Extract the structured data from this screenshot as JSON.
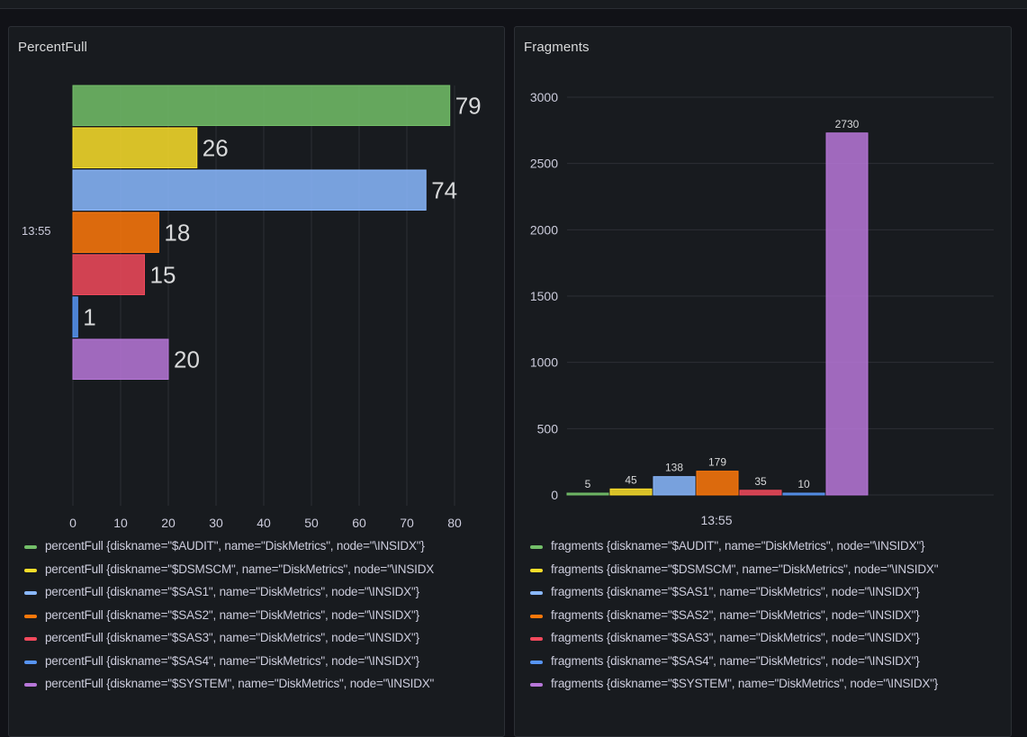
{
  "panels": [
    {
      "title": "PercentFull",
      "legend": [
        {
          "label": "percentFull {diskname=\"$AUDIT\", name=\"DiskMetrics\", node=\"\\INSIDX\"}",
          "color": "#73bf69"
        },
        {
          "label": "percentFull {diskname=\"$DSMSCM\", name=\"DiskMetrics\", node=\"\\INSIDX",
          "color": "#fade2a"
        },
        {
          "label": "percentFull {diskname=\"$SAS1\", name=\"DiskMetrics\", node=\"\\INSIDX\"}",
          "color": "#8ab8ff"
        },
        {
          "label": "percentFull {diskname=\"$SAS2\", name=\"DiskMetrics\", node=\"\\INSIDX\"}",
          "color": "#ff780a"
        },
        {
          "label": "percentFull {diskname=\"$SAS3\", name=\"DiskMetrics\", node=\"\\INSIDX\"}",
          "color": "#f2495c"
        },
        {
          "label": "percentFull {diskname=\"$SAS4\", name=\"DiskMetrics\", node=\"\\INSIDX\"}",
          "color": "#5794f2"
        },
        {
          "label": "percentFull {diskname=\"$SYSTEM\", name=\"DiskMetrics\", node=\"\\INSIDX\"",
          "color": "#b877d9"
        }
      ]
    },
    {
      "title": "Fragments",
      "legend": [
        {
          "label": "fragments {diskname=\"$AUDIT\", name=\"DiskMetrics\", node=\"\\INSIDX\"}",
          "color": "#73bf69"
        },
        {
          "label": "fragments {diskname=\"$DSMSCM\", name=\"DiskMetrics\", node=\"\\INSIDX\"",
          "color": "#fade2a"
        },
        {
          "label": "fragments {diskname=\"$SAS1\", name=\"DiskMetrics\", node=\"\\INSIDX\"}",
          "color": "#8ab8ff"
        },
        {
          "label": "fragments {diskname=\"$SAS2\", name=\"DiskMetrics\", node=\"\\INSIDX\"}",
          "color": "#ff780a"
        },
        {
          "label": "fragments {diskname=\"$SAS3\", name=\"DiskMetrics\", node=\"\\INSIDX\"}",
          "color": "#f2495c"
        },
        {
          "label": "fragments {diskname=\"$SAS4\", name=\"DiskMetrics\", node=\"\\INSIDX\"}",
          "color": "#5794f2"
        },
        {
          "label": "fragments {diskname=\"$SYSTEM\", name=\"DiskMetrics\", node=\"\\INSIDX\"}",
          "color": "#b877d9"
        }
      ]
    }
  ],
  "chart_data": [
    {
      "type": "bar",
      "orientation": "horizontal",
      "title": "PercentFull",
      "category": "13:55",
      "series": [
        {
          "name": "percentFull {diskname=\"$AUDIT\", name=\"DiskMetrics\", node=\"\\INSIDX\"}",
          "value": 79,
          "color": "#73bf69"
        },
        {
          "name": "percentFull {diskname=\"$DSMSCM\", name=\"DiskMetrics\", node=\"\\INSIDX",
          "value": 26,
          "color": "#fade2a"
        },
        {
          "name": "percentFull {diskname=\"$SAS1\", name=\"DiskMetrics\", node=\"\\INSIDX\"}",
          "value": 74,
          "color": "#8ab8ff"
        },
        {
          "name": "percentFull {diskname=\"$SAS2\", name=\"DiskMetrics\", node=\"\\INSIDX\"}",
          "value": 18,
          "color": "#ff780a"
        },
        {
          "name": "percentFull {diskname=\"$SAS3\", name=\"DiskMetrics\", node=\"\\INSIDX\"}",
          "value": 15,
          "color": "#f2495c"
        },
        {
          "name": "percentFull {diskname=\"$SAS4\", name=\"DiskMetrics\", node=\"\\INSIDX\"}",
          "value": 1,
          "color": "#5794f2"
        },
        {
          "name": "percentFull {diskname=\"$SYSTEM\", name=\"DiskMetrics\", node=\"\\INSIDX\"",
          "value": 20,
          "color": "#b877d9"
        }
      ],
      "xlim": [
        0,
        80
      ],
      "xticks": [
        0,
        10,
        20,
        30,
        40,
        50,
        60,
        70,
        80
      ],
      "grid": true,
      "legend": "bottom"
    },
    {
      "type": "bar",
      "orientation": "vertical",
      "title": "Fragments",
      "category": "13:55",
      "series": [
        {
          "name": "fragments {diskname=\"$AUDIT\", name=\"DiskMetrics\", node=\"\\INSIDX\"}",
          "value": 5,
          "color": "#73bf69"
        },
        {
          "name": "fragments {diskname=\"$DSMSCM\", name=\"DiskMetrics\", node=\"\\INSIDX\"",
          "value": 45,
          "color": "#fade2a"
        },
        {
          "name": "fragments {diskname=\"$SAS1\", name=\"DiskMetrics\", node=\"\\INSIDX\"}",
          "value": 138,
          "color": "#8ab8ff"
        },
        {
          "name": "fragments {diskname=\"$SAS2\", name=\"DiskMetrics\", node=\"\\INSIDX\"}",
          "value": 179,
          "color": "#ff780a"
        },
        {
          "name": "fragments {diskname=\"$SAS3\", name=\"DiskMetrics\", node=\"\\INSIDX\"}",
          "value": 35,
          "color": "#f2495c"
        },
        {
          "name": "fragments {diskname=\"$SAS4\", name=\"DiskMetrics\", node=\"\\INSIDX\"}",
          "value": 10,
          "color": "#5794f2"
        },
        {
          "name": "fragments {diskname=\"$SYSTEM\", name=\"DiskMetrics\", node=\"\\INSIDX\"}",
          "value": 2730,
          "color": "#b877d9"
        }
      ],
      "ylim": [
        0,
        3000
      ],
      "yticks": [
        0,
        500,
        1000,
        1500,
        2000,
        2500,
        3000
      ],
      "grid": true,
      "legend": "bottom"
    }
  ]
}
